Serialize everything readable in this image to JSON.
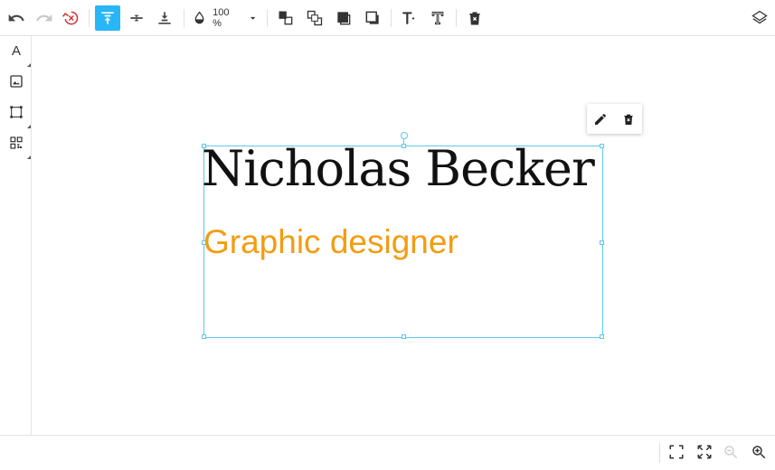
{
  "toolbar": {
    "opacity_value": "100 %",
    "accent_color": "#29b6f6",
    "buttons": [
      "undo-icon",
      "redo-icon",
      "reset-icon",
      "align-top-icon",
      "align-middle-icon",
      "align-bottom-icon",
      "opacity-icon",
      "bring-forward-icon",
      "send-backward-icon",
      "bring-to-front-icon",
      "send-to-back-icon",
      "text-size-up-icon",
      "text-size-down-icon",
      "delete-icon",
      "layers-icon"
    ]
  },
  "sidebar": {
    "text_tool_label": "A",
    "tools": [
      "text-tool-icon",
      "image-tool-icon",
      "shape-tool-icon",
      "qr-code-tool-icon"
    ]
  },
  "canvas": {
    "name_text": "Nicholas Becker",
    "role_text": "Graphic designer",
    "role_color": "#f39c12",
    "selection_color": "#5bc8ec"
  },
  "context_popup": {
    "buttons": [
      "edit-icon",
      "delete-icon"
    ]
  },
  "statusbar": {
    "buttons": [
      "fit-to-screen-icon",
      "fullscreen-icon",
      "zoom-out-icon",
      "zoom-in-icon"
    ]
  }
}
